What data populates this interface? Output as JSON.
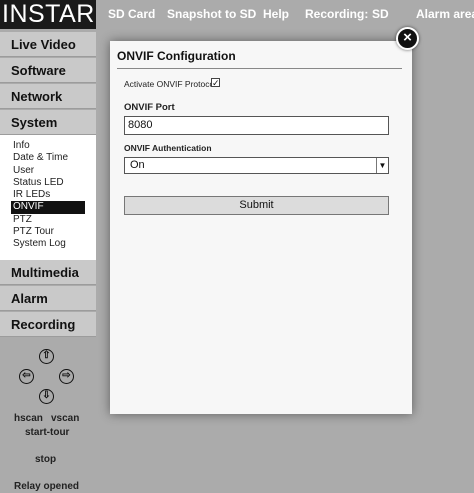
{
  "topbar": {
    "logo": "INSTAR",
    "items": [
      "SD Card",
      "Snapshot to SD",
      "Help",
      "Recording:",
      "SD",
      "Alarm area"
    ]
  },
  "sidebar": {
    "menus": [
      "Live Video",
      "Software",
      "Network",
      "System",
      "Multimedia",
      "Alarm",
      "Recording"
    ],
    "system_items": [
      "Info",
      "Date & Time",
      "User",
      "Status LED",
      "IR LEDs",
      "ONVIF",
      "PTZ",
      "PTZ Tour",
      "System Log"
    ],
    "active_item": "ONVIF"
  },
  "ptz": {
    "up_icon": "⇧",
    "left_icon": "⇦",
    "right_icon": "⇨",
    "down_icon": "⇩",
    "hscan": "hscan",
    "vscan": "vscan",
    "start_tour": "start-tour",
    "stop": "stop",
    "relay": "Relay opened"
  },
  "dialog": {
    "title": "ONVIF Configuration",
    "close_icon": "×",
    "activate_label": "Activate ONVIF Protocol",
    "activate_checked": true,
    "check_glyph": "✓",
    "port_label": "ONVIF Port",
    "port_value": "8080",
    "auth_label": "ONVIF Authentication",
    "auth_value": "On",
    "caret_glyph": "▼",
    "submit_label": "Submit"
  }
}
